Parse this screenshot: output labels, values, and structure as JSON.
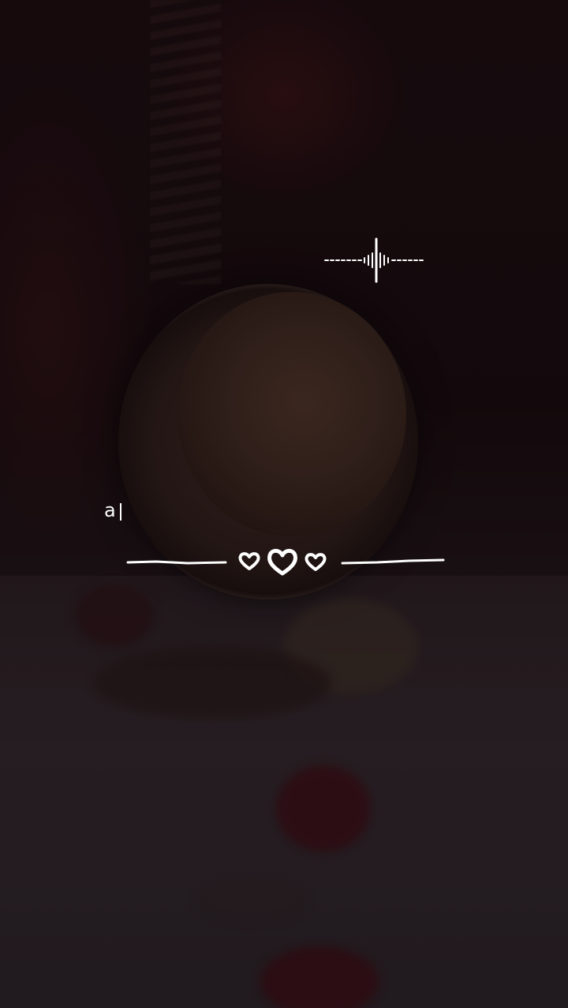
{
  "lyric": {
    "text": "a"
  },
  "decor": {
    "hearts": [
      "heart-icon",
      "heart-icon",
      "heart-icon"
    ],
    "waveform": "audio-waveform-icon",
    "accent_color": "#ffffff"
  }
}
